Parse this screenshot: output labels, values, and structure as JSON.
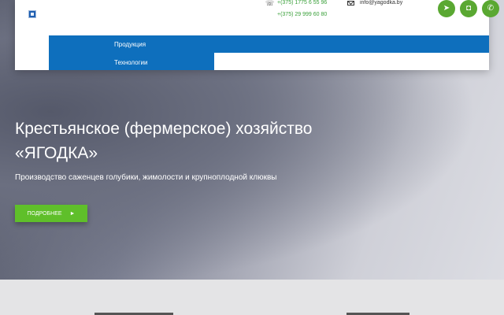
{
  "header": {
    "phones": [
      "+(375) 1775 6 55 96",
      "+(375) 29 999 60 80"
    ],
    "email": "info@yagodka.by",
    "social_icons": [
      "telegram-icon",
      "instagram-icon",
      "viber-icon"
    ]
  },
  "nav": {
    "items": [
      "Продукция",
      "Технологии"
    ]
  },
  "hero": {
    "title_line1": "Крестьянское (фермерское) хозяйство",
    "title_line2": "«ЯГОДКА»",
    "subtitle": "Производство саженцев голубики, жимолости и крупноплодной клюквы",
    "button_label": "ПОДРОБНЕЕ",
    "button_arrow": "►"
  },
  "colors": {
    "brand_blue": "#0e6fbd",
    "accent_green": "#5fbf2a",
    "phone_green": "#3aa03a"
  }
}
